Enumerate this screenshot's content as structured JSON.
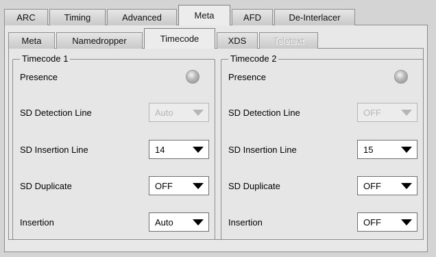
{
  "main_tabs": [
    {
      "label": "ARC",
      "active": false
    },
    {
      "label": "Timing",
      "active": false
    },
    {
      "label": "Advanced",
      "active": false
    },
    {
      "label": "Meta",
      "active": true
    },
    {
      "label": "AFD",
      "active": false
    },
    {
      "label": "De-Interlacer",
      "active": false
    }
  ],
  "sub_tabs": [
    {
      "label": "Meta",
      "active": false,
      "disabled": false
    },
    {
      "label": "Namedropper",
      "active": false,
      "disabled": false
    },
    {
      "label": "Timecode",
      "active": true,
      "disabled": false
    },
    {
      "label": "XDS",
      "active": false,
      "disabled": false
    },
    {
      "label": "Teletext",
      "active": false,
      "disabled": true
    }
  ],
  "groups": [
    {
      "title": "Timecode 1",
      "presence_label": "Presence",
      "rows": [
        {
          "label": "SD Detection Line",
          "value": "Auto",
          "disabled": true
        },
        {
          "label": "SD Insertion Line",
          "value": "14",
          "disabled": false
        },
        {
          "label": "SD Duplicate",
          "value": "OFF",
          "disabled": false
        },
        {
          "label": "Insertion",
          "value": "Auto",
          "disabled": false
        }
      ]
    },
    {
      "title": "Timecode 2",
      "presence_label": "Presence",
      "rows": [
        {
          "label": "SD Detection Line",
          "value": "OFF",
          "disabled": true
        },
        {
          "label": "SD Insertion Line",
          "value": "15",
          "disabled": false
        },
        {
          "label": "SD Duplicate",
          "value": "OFF",
          "disabled": false
        },
        {
          "label": "Insertion",
          "value": "OFF",
          "disabled": false
        }
      ]
    }
  ],
  "icons": {
    "presence_indicator": "led-indicator-icon",
    "combo_arrow": "chevron-down-icon"
  },
  "colors": {
    "led_off": "#b8b8b8",
    "panel_bg": "#e6e6e6",
    "disabled_text": "#b5b5b5"
  }
}
